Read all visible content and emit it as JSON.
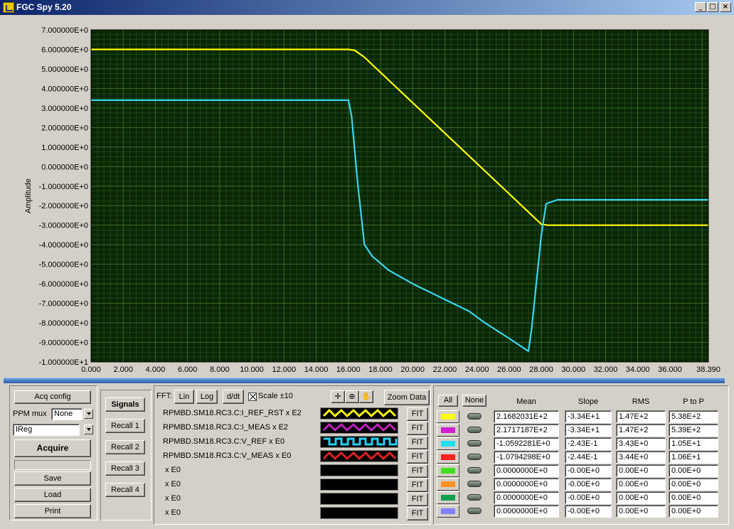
{
  "window": {
    "title": "FGC Spy 5.20"
  },
  "chart_data": {
    "type": "line",
    "ylabel": "Amplitude",
    "xlim": [
      0,
      38.39
    ],
    "ylim": [
      -10,
      7
    ],
    "grid": true,
    "xticks": [
      "0.000",
      "2.000",
      "4.000",
      "6.000",
      "8.000",
      "10.000",
      "12.000",
      "14.000",
      "16.000",
      "18.000",
      "20.000",
      "22.000",
      "24.000",
      "26.000",
      "28.000",
      "30.000",
      "32.000",
      "34.000",
      "36.000",
      "38.390"
    ],
    "yticks": [
      "7.000000E+0",
      "6.000000E+0",
      "5.000000E+0",
      "4.000000E+0",
      "3.000000E+0",
      "2.000000E+0",
      "1.000000E+0",
      "0.000000E+0",
      "-1.000000E+0",
      "-2.000000E+0",
      "-3.000000E+0",
      "-4.000000E+0",
      "-5.000000E+0",
      "-6.000000E+0",
      "-7.000000E+0",
      "-8.000000E+0",
      "-9.000000E+0",
      "-1.000000E+1"
    ],
    "series": [
      {
        "color": "#ffff00",
        "x": [
          0,
          16.0,
          16.4,
          17.0,
          28.0,
          28.4,
          38.39
        ],
        "y": [
          6.0,
          6.0,
          5.95,
          5.6,
          -2.95,
          -3.0,
          -3.0
        ]
      },
      {
        "color": "#3ad6f0",
        "x": [
          0,
          16.0,
          16.2,
          16.6,
          17.0,
          17.5,
          18.5,
          20.0,
          22.0,
          23.5,
          24.5,
          26.0,
          27.2,
          27.4,
          28.0,
          28.3,
          29.0,
          38.39
        ],
        "y": [
          3.4,
          3.4,
          2.6,
          -1.0,
          -4.0,
          -4.6,
          -5.3,
          -6.0,
          -6.8,
          -7.4,
          -8.0,
          -8.8,
          -9.45,
          -8.3,
          -3.5,
          -1.9,
          -1.7,
          -1.7
        ]
      }
    ]
  },
  "controls": {
    "acq_config": "Acq config",
    "ppm_mux_label": "PPM mux",
    "ppm_mux_value": "None",
    "source_value": "IReg",
    "acquire": "Acquire",
    "save": "Save",
    "load": "Load",
    "print": "Print"
  },
  "signals_panel": {
    "signals": "Signals",
    "recalls": [
      "Recall 1",
      "Recall 2",
      "Recall 3",
      "Recall 4"
    ]
  },
  "toolbar": {
    "fft_label": "FFT:",
    "lin": "Lin",
    "log": "Log",
    "ddt": "d/dt",
    "scale_label": "Scale ±10",
    "zoom_data": "Zoom Data"
  },
  "channels": [
    {
      "label": "RPMBD.SM18.RC3.C:I_REF_RST x E2",
      "wave": "zigzag",
      "color": "#ffff00",
      "fit": "FIT"
    },
    {
      "label": "RPMBD.SM18.RC3.C:I_MEAS x E2",
      "wave": "zigzag",
      "color": "#c020c0",
      "fit": "FIT"
    },
    {
      "label": "RPMBD.SM18.RC3.C:V_REF x E0",
      "wave": "square",
      "color": "#20d0f0",
      "fit": "FIT"
    },
    {
      "label": "RPMBD.SM18.RC3.C:V_MEAS x E0",
      "wave": "zigzag",
      "color": "#e02020",
      "fit": "FIT"
    },
    {
      "label": "x E0",
      "wave": "none",
      "color": "#000000",
      "fit": "FIT"
    },
    {
      "label": "x E0",
      "wave": "none",
      "color": "#000000",
      "fit": "FIT"
    },
    {
      "label": "x E0",
      "wave": "none",
      "color": "#000000",
      "fit": "FIT"
    },
    {
      "label": "x E0",
      "wave": "none",
      "color": "#000000",
      "fit": "FIT"
    }
  ],
  "stats": {
    "all": "All",
    "none": "None",
    "headers": [
      "Mean",
      "Slope",
      "RMS",
      "P to P"
    ],
    "rows": [
      {
        "color": "#ffff00",
        "mean": "2.1682031E+2",
        "slope": "-3.34E+1",
        "rms": "1.47E+2",
        "ptp": "5.38E+2"
      },
      {
        "color": "#d020d0",
        "mean": "2.1717187E+2",
        "slope": "-3.34E+1",
        "rms": "1.47E+2",
        "ptp": "5.39E+2"
      },
      {
        "color": "#20e0f0",
        "mean": "-1.0592281E+0",
        "slope": "-2.43E-1",
        "rms": "3.43E+0",
        "ptp": "1.05E+1"
      },
      {
        "color": "#ff2020",
        "mean": "-1.0794298E+0",
        "slope": "-2.44E-1",
        "rms": "3.44E+0",
        "ptp": "1.06E+1"
      },
      {
        "color": "#40e020",
        "mean": "0.0000000E+0",
        "slope": "-0.00E+0",
        "rms": "0.00E+0",
        "ptp": "0.00E+0"
      },
      {
        "color": "#ff9020",
        "mean": "0.0000000E+0",
        "slope": "-0.00E+0",
        "rms": "0.00E+0",
        "ptp": "0.00E+0"
      },
      {
        "color": "#10a050",
        "mean": "0.0000000E+0",
        "slope": "-0.00E+0",
        "rms": "0.00E+0",
        "ptp": "0.00E+0"
      },
      {
        "color": "#8080ff",
        "mean": "0.0000000E+0",
        "slope": "-0.00E+0",
        "rms": "0.00E+0",
        "ptp": "0.00E+0"
      }
    ]
  }
}
